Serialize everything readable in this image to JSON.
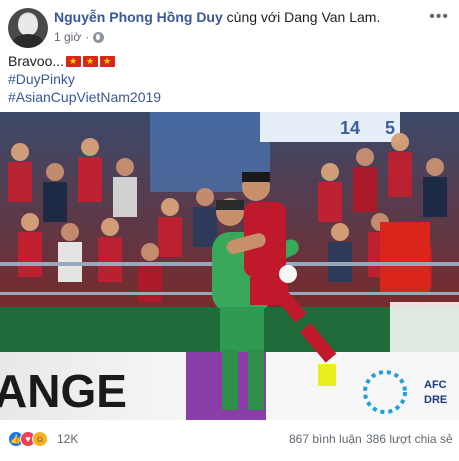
{
  "post": {
    "author": "Nguyễn Phong Hồng Duy",
    "with_text": "cùng với",
    "tagged": "Dang Van Lam",
    "tagged_suffix": ".",
    "time": "1 giờ",
    "time_separator": "·",
    "more_label": "•••",
    "text_line_1": "Bravoo...",
    "hashtag_1": "#DuyPinky",
    "hashtag_2": "#AsianCupVietNam2019"
  },
  "photo": {
    "banner_text": "ANGE",
    "banner_right": "AFC",
    "banner_right_2": "DRE",
    "scoreboard": "14",
    "scoreboard_2": "5"
  },
  "reactions": {
    "like_icon": "like-icon",
    "love_icon": "love-icon",
    "haha_icon": "haha-icon",
    "count": "12K",
    "comments": "867 bình luận",
    "shares": "386 lượt chia sẻ"
  },
  "colors": {
    "link": "#385898",
    "meta": "#616770",
    "like": "#1877f2",
    "love": "#f33e58",
    "haha": "#f7b125",
    "jersey_red": "#c0192b",
    "keeper_green": "#39a85a"
  }
}
